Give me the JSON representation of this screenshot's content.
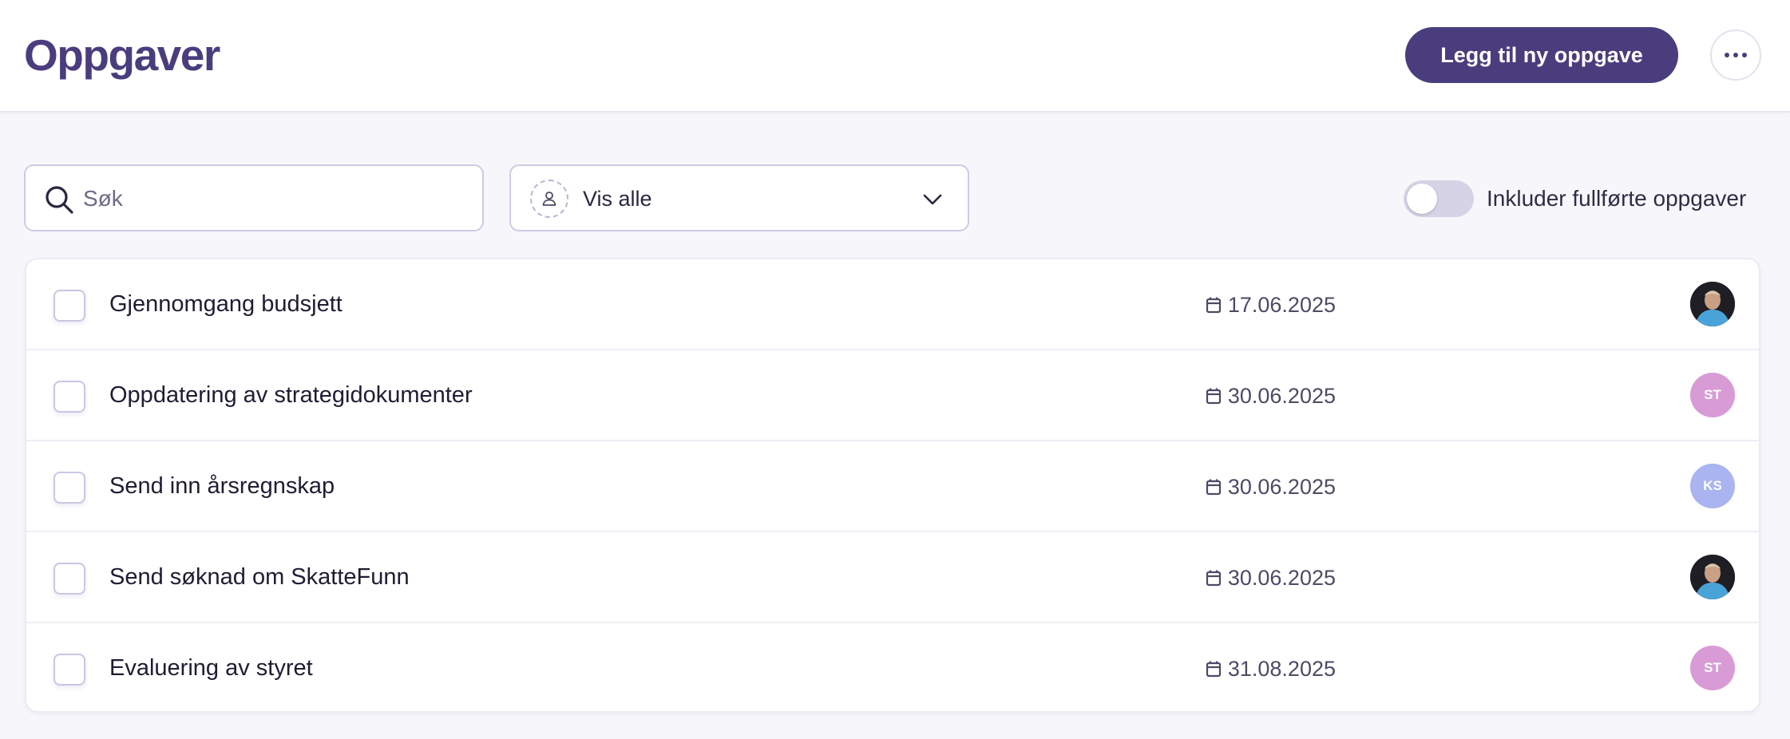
{
  "header": {
    "title": "Oppgaver",
    "add_button_label": "Legg til ny oppgave"
  },
  "filters": {
    "search_placeholder": "Søk",
    "search_value": "",
    "assignee_selected": "Vis alle",
    "include_completed_label": "Inkluder fullførte oppgaver",
    "include_completed": false
  },
  "tasks": [
    {
      "title": "Gjennomgang budsjett",
      "due": "17.06.2025",
      "assignee": {
        "type": "photo",
        "initials": "",
        "color": "#1e1e24"
      }
    },
    {
      "title": "Oppdatering av strategidokumenter",
      "due": "30.06.2025",
      "assignee": {
        "type": "initials",
        "initials": "ST",
        "color": "#d89bd6"
      }
    },
    {
      "title": "Send inn årsregnskap",
      "due": "30.06.2025",
      "assignee": {
        "type": "initials",
        "initials": "KS",
        "color": "#a9b4f0"
      }
    },
    {
      "title": "Send søknad om SkatteFunn",
      "due": "30.06.2025",
      "assignee": {
        "type": "photo",
        "initials": "",
        "color": "#1e1e24"
      }
    },
    {
      "title": "Evaluering av styret",
      "due": "31.08.2025",
      "assignee": {
        "type": "initials",
        "initials": "ST",
        "color": "#d89bd6"
      }
    }
  ],
  "colors": {
    "brand": "#4a3d7d",
    "background": "#f7f7fb",
    "border": "#cfcbe4"
  },
  "icons": {
    "search": "search-icon",
    "more": "more-horizontal-icon",
    "assignee_filter": "user-icon",
    "chevron": "chevron-down-icon",
    "date": "calendar-icon"
  }
}
